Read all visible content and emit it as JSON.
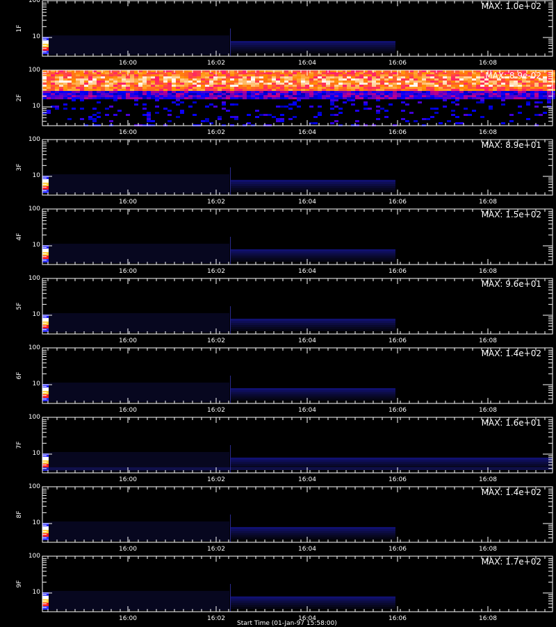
{
  "chart_data": [
    {
      "type": "heatmap",
      "channel": "1F",
      "max_label": "MAX: 1.0e+02",
      "yticks": [
        "100",
        "10"
      ],
      "xticks": [
        "16:00",
        "16:02",
        "16:04",
        "16:06",
        "16:08"
      ],
      "yscale": "log",
      "profile": "burst"
    },
    {
      "type": "heatmap",
      "channel": "2F",
      "max_label": "MAX: 8.9e-02",
      "yticks": [
        "100",
        "10"
      ],
      "xticks": [
        "16:00",
        "16:02",
        "16:04",
        "16:06",
        "16:08"
      ],
      "yscale": "log",
      "profile": "noise"
    },
    {
      "type": "heatmap",
      "channel": "3F",
      "max_label": "MAX: 8.9e+01",
      "yticks": [
        "100",
        "10"
      ],
      "xticks": [
        "16:00",
        "16:02",
        "16:04",
        "16:06",
        "16:08"
      ],
      "yscale": "log",
      "profile": "burst"
    },
    {
      "type": "heatmap",
      "channel": "4F",
      "max_label": "MAX: 1.5e+02",
      "yticks": [
        "100",
        "10"
      ],
      "xticks": [
        "16:00",
        "16:02",
        "16:04",
        "16:06",
        "16:08"
      ],
      "yscale": "log",
      "profile": "burst"
    },
    {
      "type": "heatmap",
      "channel": "5F",
      "max_label": "MAX: 9.6e+01",
      "yticks": [
        "100",
        "10"
      ],
      "xticks": [
        "16:00",
        "16:02",
        "16:04",
        "16:06",
        "16:08"
      ],
      "yscale": "log",
      "profile": "burst"
    },
    {
      "type": "heatmap",
      "channel": "6F",
      "max_label": "MAX: 1.4e+02",
      "yticks": [
        "100",
        "10"
      ],
      "xticks": [
        "16:00",
        "16:02",
        "16:04",
        "16:06",
        "16:08"
      ],
      "yscale": "log",
      "profile": "burst"
    },
    {
      "type": "heatmap",
      "channel": "7F",
      "max_label": "MAX: 1.6e+01",
      "yticks": [
        "100",
        "10"
      ],
      "xticks": [
        "16:00",
        "16:02",
        "16:04",
        "16:06",
        "16:08"
      ],
      "yscale": "log",
      "profile": "burst-wide"
    },
    {
      "type": "heatmap",
      "channel": "8F",
      "max_label": "MAX: 1.4e+02",
      "yticks": [
        "100",
        "10"
      ],
      "xticks": [
        "16:00",
        "16:02",
        "16:04",
        "16:06",
        "16:08"
      ],
      "yscale": "log",
      "profile": "burst"
    },
    {
      "type": "heatmap",
      "channel": "9F",
      "max_label": "MAX: 1.7e+02",
      "yticks": [
        "100",
        "10"
      ],
      "xticks": [
        "16:00",
        "16:02",
        "16:04",
        "16:06",
        "16:08"
      ],
      "yscale": "log",
      "profile": "burst"
    }
  ],
  "footer_label": "Start Time (01-Jan-97 15:58:00)",
  "colors": {
    "axis": "#ffffff",
    "background": "#000000"
  }
}
